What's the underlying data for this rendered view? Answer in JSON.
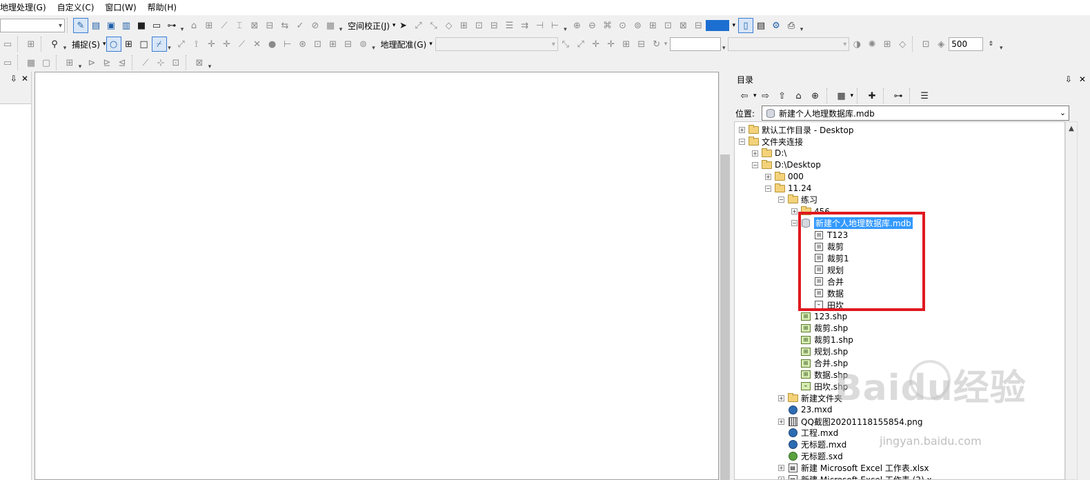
{
  "menu": {
    "items": [
      "地理处理(G)",
      "自定义(C)",
      "窗口(W)",
      "帮助(H)"
    ]
  },
  "toolbar": {
    "spatial_adjust_label": "空间校正(J)",
    "snapping_label": "捕捉(S)",
    "georef_label": "地理配准(G)",
    "scale_value": "500"
  },
  "catalog": {
    "title": "目录",
    "location_label": "位置:",
    "location_value": "新建个人地理数据库.mdb",
    "tree": [
      {
        "label": "默认工作目录 - Desktop",
        "icon": "home-folder-icon",
        "level": 0,
        "expander": "+"
      },
      {
        "label": "文件夹连接",
        "icon": "folder-connection-icon",
        "level": 0,
        "expander": "-"
      },
      {
        "label": "D:\\",
        "icon": "folder-icon",
        "level": 1,
        "expander": "+"
      },
      {
        "label": "D:\\Desktop",
        "icon": "folder-icon",
        "level": 1,
        "expander": "-"
      },
      {
        "label": "000",
        "icon": "folder-icon",
        "level": 2,
        "expander": "+"
      },
      {
        "label": "11.24",
        "icon": "folder-icon",
        "level": 2,
        "expander": "-"
      },
      {
        "label": "练习",
        "icon": "folder-icon",
        "level": 3,
        "expander": "-"
      },
      {
        "label": "456",
        "icon": "folder-icon",
        "level": 4,
        "expander": "+"
      },
      {
        "label": "新建个人地理数据库.mdb",
        "icon": "database-icon",
        "level": 4,
        "expander": "-",
        "selected": true
      },
      {
        "label": "T123",
        "icon": "feature-class-icon",
        "level": 5,
        "expander": ""
      },
      {
        "label": "裁剪",
        "icon": "feature-class-icon",
        "level": 5,
        "expander": ""
      },
      {
        "label": "裁剪1",
        "icon": "feature-class-icon",
        "level": 5,
        "expander": ""
      },
      {
        "label": "规划",
        "icon": "feature-class-icon",
        "level": 5,
        "expander": ""
      },
      {
        "label": "合并",
        "icon": "feature-class-icon",
        "level": 5,
        "expander": ""
      },
      {
        "label": "数据",
        "icon": "feature-class-icon",
        "level": 5,
        "expander": ""
      },
      {
        "label": "田坎",
        "icon": "line-feature-class-icon",
        "level": 5,
        "expander": ""
      },
      {
        "label": "123.shp",
        "icon": "shapefile-icon",
        "level": 4,
        "expander": ""
      },
      {
        "label": "裁剪.shp",
        "icon": "shapefile-icon",
        "level": 4,
        "expander": ""
      },
      {
        "label": "裁剪1.shp",
        "icon": "shapefile-icon",
        "level": 4,
        "expander": ""
      },
      {
        "label": "规划.shp",
        "icon": "shapefile-icon",
        "level": 4,
        "expander": ""
      },
      {
        "label": "合并.shp",
        "icon": "shapefile-icon",
        "level": 4,
        "expander": ""
      },
      {
        "label": "数据.shp",
        "icon": "shapefile-icon",
        "level": 4,
        "expander": ""
      },
      {
        "label": "田坎.shp",
        "icon": "line-shapefile-icon",
        "level": 4,
        "expander": ""
      },
      {
        "label": "新建文件夹",
        "icon": "folder-icon",
        "level": 3,
        "expander": "+"
      },
      {
        "label": "23.mxd",
        "icon": "mxd-icon",
        "level": 3,
        "expander": ""
      },
      {
        "label": "QQ截图20201118155854.png",
        "icon": "raster-icon",
        "level": 3,
        "expander": "+"
      },
      {
        "label": "工程.mxd",
        "icon": "mxd-icon",
        "level": 3,
        "expander": ""
      },
      {
        "label": "无标题.mxd",
        "icon": "mxd-icon",
        "level": 3,
        "expander": ""
      },
      {
        "label": "无标题.sxd",
        "icon": "sxd-icon",
        "level": 3,
        "expander": ""
      },
      {
        "label": "新建 Microsoft Excel 工作表.xlsx",
        "icon": "excel-icon",
        "level": 3,
        "expander": "+"
      },
      {
        "label": "新建 Microsoft Excel 工作表 (2).x",
        "icon": "excel-icon",
        "level": 3,
        "expander": "+"
      }
    ]
  },
  "watermark": {
    "text": "Baidu经验",
    "url": "jingyan.baidu.com"
  },
  "colors": {
    "selection": "#3399ff",
    "highlight_box": "#e0191f"
  }
}
